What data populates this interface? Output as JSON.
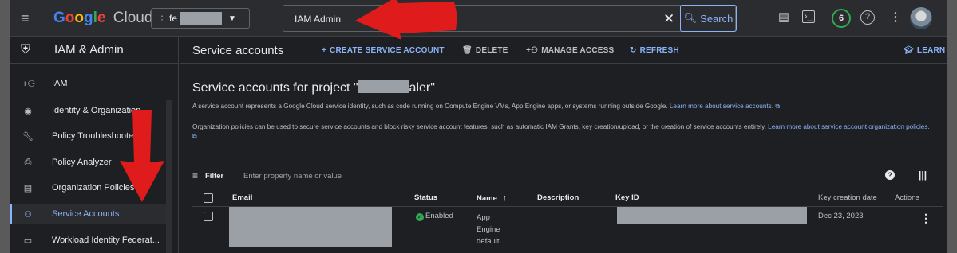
{
  "topbar": {
    "menu_icon": "hamburger-icon",
    "logo": {
      "g": "Google",
      "cloud": "Cloud"
    },
    "project": {
      "name_prefix": "fe"
    },
    "search": {
      "query": "IAM Admin",
      "button": "Search"
    },
    "notifications_count": "6"
  },
  "sidebar": {
    "title": "IAM & Admin",
    "items": [
      {
        "label": "IAM",
        "icon": "add-person-icon"
      },
      {
        "label": "Identity & Organization",
        "icon": "account-circle-icon"
      },
      {
        "label": "Policy Troubleshooter",
        "icon": "wrench-icon"
      },
      {
        "label": "Policy Analyzer",
        "icon": "document-search-icon"
      },
      {
        "label": "Organization Policies",
        "icon": "list-box-icon"
      },
      {
        "label": "Service Accounts",
        "icon": "service-account-icon",
        "active": true
      },
      {
        "label": "Workload Identity Federat...",
        "icon": "id-card-icon"
      }
    ]
  },
  "main": {
    "page_title": "Service accounts",
    "actions": {
      "create": "CREATE SERVICE ACCOUNT",
      "delete": "DELETE",
      "manage": "MANAGE ACCESS",
      "refresh": "REFRESH",
      "learn": "LEARN"
    },
    "heading_prefix": "Service accounts for project \"",
    "heading_suffix": "aler\"",
    "para1_text": "A service account represents a Google Cloud service identity, such as code running on Compute Engine VMs, App Engine apps, or systems running outside Google. ",
    "para1_link": "Learn more about service accounts.",
    "para2_text": "Organization policies can be used to secure service accounts and block risky service account features, such as automatic IAM Grants, key creation/upload, or the creation of service accounts entirely. ",
    "para2_link_a": "Learn more",
    "para2_link_b": "about service account organization policies.",
    "filter": {
      "label": "Filter",
      "placeholder": "Enter property name or value"
    },
    "table": {
      "headers": {
        "email": "Email",
        "status": "Status",
        "name": "Name",
        "description": "Description",
        "key_id": "Key ID",
        "key_date": "Key creation date",
        "actions": "Actions"
      },
      "sort_indicator": "↑",
      "rows": [
        {
          "status": "Enabled",
          "name_lines": [
            "App",
            "Engine",
            "default"
          ],
          "key_date": "Dec 23, 2023"
        }
      ]
    }
  }
}
